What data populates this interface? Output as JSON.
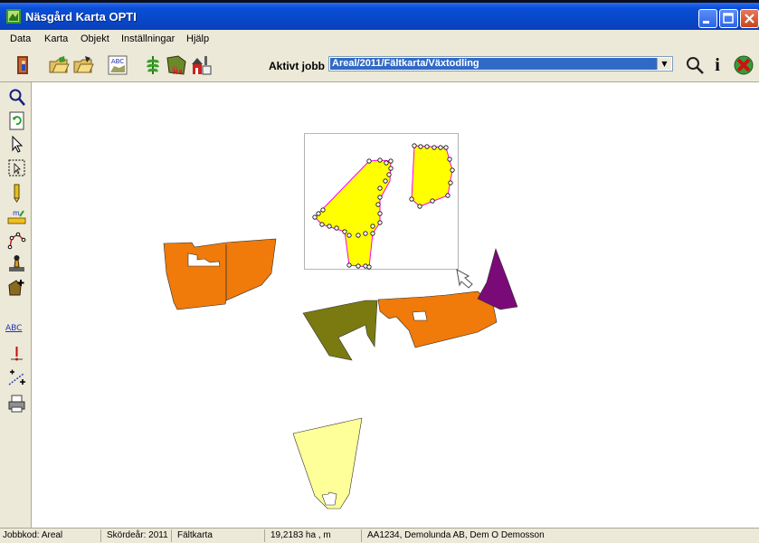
{
  "window": {
    "title": "Näsgård Karta OPTI"
  },
  "menu": {
    "items": [
      "Data",
      "Karta",
      "Objekt",
      "Inställningar",
      "Hjälp"
    ]
  },
  "toolbar": {
    "aktivt_jobb_label": "Aktivt jobb",
    "job_value": "Areal/2011/Fältkarta/Växtodling",
    "abc_label": "ABC",
    "ha_label": "HA",
    "info_label": "i"
  },
  "leftbar": {
    "m_label": "m",
    "abc_label": "ABC"
  },
  "statusbar": {
    "jobbkod": "Jobbkod: Areal",
    "skordear": "Skördeår: 2011",
    "kartyp": "Fältkarta",
    "area": "19,2183 ha ,  m",
    "owner": "AA1234, Demolunda AB, Dem O Demosson"
  },
  "colors": {
    "titlebar": "#0a4fd8",
    "chrome": "#ece9d8",
    "field_orange": "#f07a0a",
    "field_olive": "#7a7a10",
    "field_purple": "#7a0a78",
    "field_light_yellow": "#ffff99",
    "field_selected_yellow": "#ffff00",
    "selection_outline": "#ff00ff"
  }
}
